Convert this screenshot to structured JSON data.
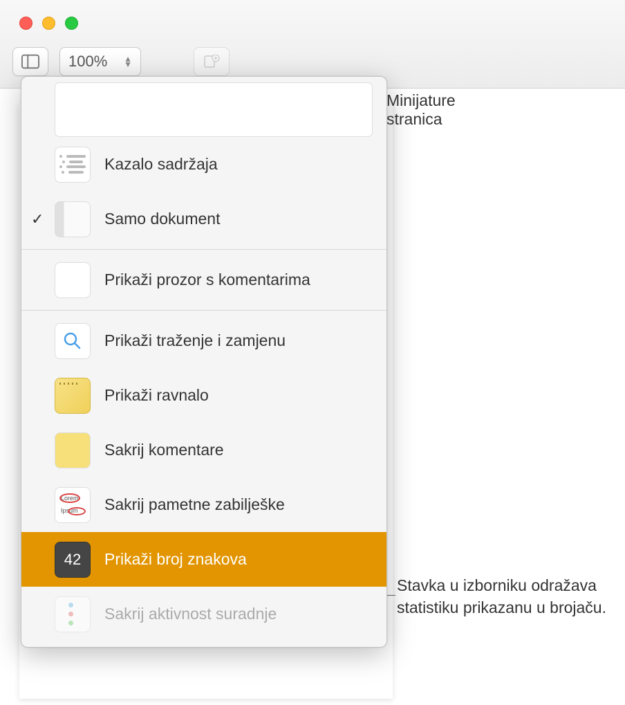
{
  "toolbar": {
    "zoom_value": "100%"
  },
  "menu": {
    "items": [
      {
        "label": "Minijature stranica",
        "icon": "thumbnails-icon",
        "checked": false
      },
      {
        "label": "Kazalo sadržaja",
        "icon": "toc-icon",
        "checked": false
      },
      {
        "label": "Samo dokument",
        "icon": "document-only-icon",
        "checked": true
      }
    ],
    "items2": [
      {
        "label": "Prikaži prozor s komentarima",
        "icon": "comments-panel-icon"
      }
    ],
    "items3": [
      {
        "label": "Prikaži traženje i zamjenu",
        "icon": "search-icon"
      },
      {
        "label": "Prikaži ravnalo",
        "icon": "ruler-icon"
      },
      {
        "label": "Sakrij komentare",
        "icon": "hide-comments-icon"
      },
      {
        "label": "Sakrij pametne zabilješke",
        "icon": "smart-annotations-icon"
      },
      {
        "label": "Prikaži broj znakova",
        "icon": "word-count-icon",
        "highlighted": true,
        "badge": "42"
      },
      {
        "label": "Sakrij aktivnost suradnje",
        "icon": "collaboration-icon",
        "disabled": true
      }
    ]
  },
  "callout": {
    "text": "Stavka u izborniku odražava statistiku prikazanu u brojaču."
  }
}
